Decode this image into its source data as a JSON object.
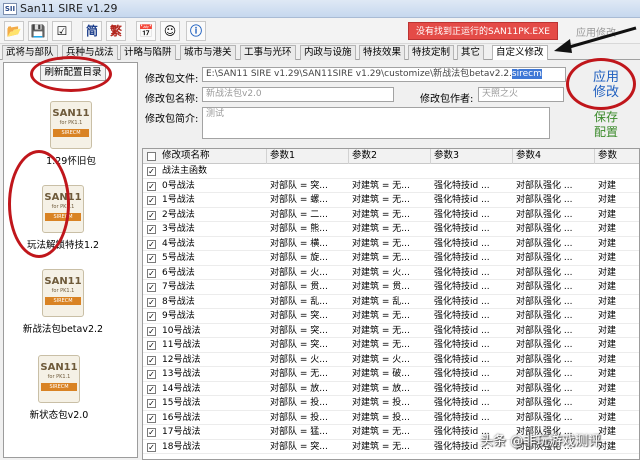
{
  "window": {
    "app_icon_text": "SII",
    "title": "San11 SIRE v1.29"
  },
  "toolbar": {
    "btn_simplified": "简",
    "btn_traditional": "繁",
    "warning": "没有找到正运行的SAN11PK.EXE",
    "apply_top": "应用修改"
  },
  "tabs": [
    "武将与部队",
    "兵种与战法",
    "计略与陷阱",
    "城市与港关",
    "工事与光环",
    "内政与设施",
    "特技效果",
    "特技定制",
    "其它",
    "自定义修改"
  ],
  "left": {
    "refresh_label": "刷新配置目录",
    "packages": [
      {
        "icon_title": "SAN11",
        "icon_sub": "for PK1.1",
        "icon_band": "SIRECM",
        "label": "1.29怀旧包"
      },
      {
        "icon_title": "SAN11",
        "icon_sub": "for PK1.1",
        "icon_band": "SIRECM",
        "label": "玩法解锁特技1.2"
      },
      {
        "icon_title": "SAN11",
        "icon_sub": "for PK1.1",
        "icon_band": "SIRECM",
        "label": "新战法包betav2.2"
      },
      {
        "icon_title": "SAN11",
        "icon_sub": "for PK1.1",
        "icon_band": "SIRECM",
        "label": "新状态包v2.0"
      }
    ]
  },
  "form": {
    "file_label": "修改包文件:",
    "file_value_prefix": "E:\\SAN11 SIRE v1.29\\SAN11SIRE v1.29\\customize\\新战法包betav2.2.",
    "file_value_ext": "sirecm",
    "name_label": "修改包名称:",
    "name_placeholder": "新战法包v2.0",
    "author_label": "修改包作者:",
    "author_placeholder": "天照之火",
    "desc_label": "修改包简介:",
    "desc_placeholder": "测试",
    "apply_line1": "应用",
    "apply_line2": "修改",
    "save_line1": "保存",
    "save_line2": "配置"
  },
  "grid": {
    "headers": [
      "修改项名称",
      "参数1",
      "参数2",
      "参数3",
      "参数4",
      "参数"
    ],
    "rows": [
      [
        "战法主函数",
        "",
        "",
        "",
        "",
        ""
      ],
      [
        "0号战法",
        "对部队 = 突...",
        "对建筑 = 无...",
        "强化特技id ...",
        "对部队强化 ...",
        "对建"
      ],
      [
        "1号战法",
        "对部队 = 螺...",
        "对建筑 = 无...",
        "强化特技id ...",
        "对部队强化 ...",
        "对建"
      ],
      [
        "2号战法",
        "对部队 = 二...",
        "对建筑 = 无...",
        "强化特技id ...",
        "对部队强化 ...",
        "对建"
      ],
      [
        "3号战法",
        "对部队 = 熊...",
        "对建筑 = 无...",
        "强化特技id ...",
        "对部队强化 ...",
        "对建"
      ],
      [
        "4号战法",
        "对部队 = 横...",
        "对建筑 = 无...",
        "强化特技id ...",
        "对部队强化 ...",
        "对建"
      ],
      [
        "5号战法",
        "对部队 = 旋...",
        "对建筑 = 无...",
        "强化特技id ...",
        "对部队强化 ...",
        "对建"
      ],
      [
        "6号战法",
        "对部队 = 火...",
        "对建筑 = 火...",
        "强化特技id ...",
        "对部队强化 ...",
        "对建"
      ],
      [
        "7号战法",
        "对部队 = 贯...",
        "对建筑 = 贯...",
        "强化特技id ...",
        "对部队强化 ...",
        "对建"
      ],
      [
        "8号战法",
        "对部队 = 乱...",
        "对建筑 = 乱...",
        "强化特技id ...",
        "对部队强化 ...",
        "对建"
      ],
      [
        "9号战法",
        "对部队 = 突...",
        "对建筑 = 无...",
        "强化特技id ...",
        "对部队强化 ...",
        "对建"
      ],
      [
        "10号战法",
        "对部队 = 突...",
        "对建筑 = 无...",
        "强化特技id ...",
        "对部队强化 ...",
        "对建"
      ],
      [
        "11号战法",
        "对部队 = 突...",
        "对建筑 = 无...",
        "强化特技id ...",
        "对部队强化 ...",
        "对建"
      ],
      [
        "12号战法",
        "对部队 = 火...",
        "对建筑 = 火...",
        "强化特技id ...",
        "对部队强化 ...",
        "对建"
      ],
      [
        "13号战法",
        "对部队 = 无...",
        "对建筑 = 破...",
        "强化特技id ...",
        "对部队强化 ...",
        "对建"
      ],
      [
        "14号战法",
        "对部队 = 放...",
        "对建筑 = 放...",
        "强化特技id ...",
        "对部队强化 ...",
        "对建"
      ],
      [
        "15号战法",
        "对部队 = 投...",
        "对建筑 = 投...",
        "强化特技id ...",
        "对部队强化 ...",
        "对建"
      ],
      [
        "16号战法",
        "对部队 = 投...",
        "对建筑 = 投...",
        "强化特技id ...",
        "对部队强化 ...",
        "对建"
      ],
      [
        "17号战法",
        "对部队 = 猛...",
        "对建筑 = 无...",
        "强化特技id ...",
        "对部队强化 ...",
        "对建"
      ],
      [
        "18号战法",
        "对部队 = 突...",
        "对建筑 = 无...",
        "强化特技id ...",
        "对部队强化 ...",
        "对建"
      ]
    ]
  },
  "watermark": "头条 @非玩游戏测评",
  "colors": {
    "warning_bg": "#e44b47",
    "annotation_red": "#c0161b",
    "apply_blue": "#1f5fbf",
    "save_green": "#3a8a2a"
  }
}
